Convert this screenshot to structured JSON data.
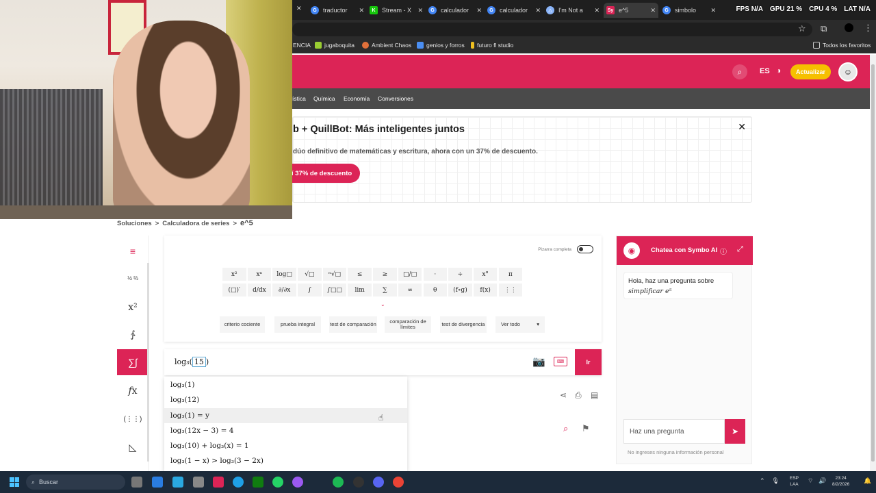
{
  "tabs": [
    {
      "label": "traductor",
      "color": "#4285f4"
    },
    {
      "label": "Stream - X",
      "color": "#16c60c"
    },
    {
      "label": "calculador",
      "color": "#4285f4"
    },
    {
      "label": "calculador",
      "color": "#4285f4"
    },
    {
      "label": "I'm Not a",
      "color": "#8ab4f8"
    },
    {
      "label": "e^5",
      "color": "#dc2456",
      "fav_text": "Sy",
      "active": true
    },
    {
      "label": "simbolo",
      "color": "#4285f4"
    }
  ],
  "perf": {
    "fps": "FPS N/A",
    "gpu": "GPU 21 %",
    "cpu": "CPU 4 %",
    "lat": "LAT N/A"
  },
  "bookmarks": [
    {
      "label": "ENCIA",
      "color": "#2b2b2b"
    },
    {
      "label": "jugaboquita",
      "color": "#9acd32"
    },
    {
      "label": "Ambient Chaos",
      "color": "#e0703a"
    },
    {
      "label": "genios y forros",
      "color": "#4a8ef2"
    },
    {
      "label": "futuro fl studio",
      "color": "#f0c020"
    }
  ],
  "bookmarks_all": "Todos los favoritos",
  "site_header": {
    "lang": "ES",
    "upgrade": "Actualizar"
  },
  "subnav": [
    "ística",
    "Química",
    "Economía",
    "Conversiones"
  ],
  "banner": {
    "title": "b + QuillBot: Más inteligentes juntos",
    "subtitle": "dúo definitivo de matemáticas y escritura, ahora con un 37% de descuento.",
    "cta": "í 37% de descuento"
  },
  "breadcrumb": {
    "items": [
      "Soluciones",
      "Calculadora de series"
    ],
    "current": "e^5",
    "sep": ">"
  },
  "rail": [
    "≡",
    "½ ⅔",
    "x²",
    "∱",
    "∑∫",
    "𝑓x",
    "(⋮⋮)",
    "◺"
  ],
  "keypad": {
    "full_board_label": "Pizarra completa",
    "row1": [
      "x²",
      "xⁿ",
      "log□",
      "√□",
      "ⁿ√□",
      "≤",
      "≥",
      "□/□",
      "·",
      "÷",
      "x°",
      "π"
    ],
    "row2": [
      "(□)′",
      "d/dx",
      "∂/∂x",
      "∫",
      "∫□□",
      "lim",
      "∑",
      "∞",
      "θ",
      "(f∘g)",
      "f(x)",
      "⋮⋮"
    ],
    "categories": [
      "criterio cociente",
      "prueba integral",
      "test de comparación",
      "comparación de límites",
      "test de divergencia"
    ],
    "see_all": "Ver todo"
  },
  "input": {
    "prefix": "log₃(",
    "arg": "15",
    "suffix": ")",
    "go": "Ir"
  },
  "suggestions": [
    "log₃(1)",
    "log₃(12)",
    "log₃(1) = y",
    "log₃(12x − 3) = 4",
    "log₃(10) + log₃(x) = 1",
    "log₃(1 − x) > log₃(3 − 2x)"
  ],
  "chat": {
    "title": "Chatea con Symbo AI",
    "greeting": "Hola, haz una pregunta sobre",
    "greeting_math": "simplificar e⁵",
    "placeholder": "Haz una pregunta",
    "note": "No ingreses ninguna información personal"
  },
  "taskbar": {
    "search": "Buscar",
    "lang1": "ESP",
    "lang2": "LAA",
    "time": "23:24",
    "date": "8/2/2026"
  },
  "colors": {
    "brand": "#dc2456",
    "upgrade": "#f6c000"
  }
}
